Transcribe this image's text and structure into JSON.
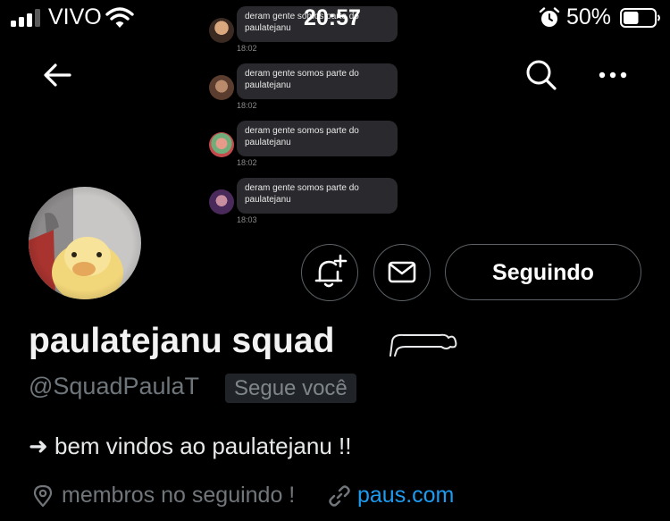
{
  "status_bar": {
    "carrier": "VIVO",
    "time": "20:57",
    "battery_percent": "50%",
    "battery_level": 0.5,
    "icons": [
      "signal-icon",
      "wifi-icon",
      "alarm-icon",
      "battery-icon"
    ]
  },
  "nav": {
    "icons": [
      "back-arrow-icon",
      "search-icon",
      "more-icon"
    ]
  },
  "chat_overlay": [
    {
      "text": "deram gente somos parte do paulatejanu",
      "time": "18:02"
    },
    {
      "text": "deram gente somos parte do paulatejanu",
      "time": "18:02"
    },
    {
      "text": "deram gente somos parte do paulatejanu",
      "time": "18:02"
    },
    {
      "text": "deram gente somos parte do paulatejanu",
      "time": "18:03"
    }
  ],
  "profile": {
    "display_name": "paulatejanu squad",
    "handle": "@SquadPaulaT",
    "follows_you": "Segue você",
    "bio": "➜ bem vindos ao paulatejanu !!",
    "location": "membros no seguindo !",
    "link": "paus.com"
  },
  "actions": {
    "following_label": "Seguindo",
    "icons": [
      "notification-bell-add-icon",
      "mail-icon"
    ]
  },
  "colors": {
    "background": "#000000",
    "text_primary": "#e7e9ea",
    "text_secondary": "#71767b",
    "link": "#1d9bf0",
    "border": "#5b6166"
  }
}
